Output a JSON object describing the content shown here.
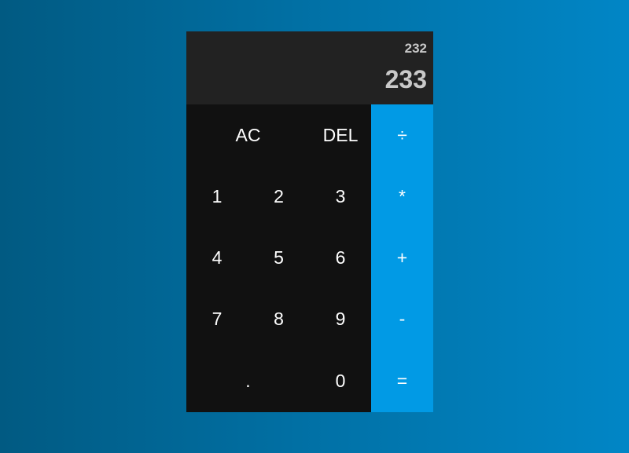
{
  "display": {
    "previous": "232",
    "current": "233"
  },
  "keys": {
    "clear": "AC",
    "delete": "DEL",
    "divide": "÷",
    "multiply": "*",
    "add": "+",
    "subtract": "-",
    "equals": "=",
    "decimal": ".",
    "digit_0": "0",
    "digit_1": "1",
    "digit_2": "2",
    "digit_3": "3",
    "digit_4": "4",
    "digit_5": "5",
    "digit_6": "6",
    "digit_7": "7",
    "digit_8": "8",
    "digit_9": "9"
  },
  "colors": {
    "operator_background": "#019ae5",
    "keypad_background": "#111111",
    "display_background": "#222222"
  }
}
